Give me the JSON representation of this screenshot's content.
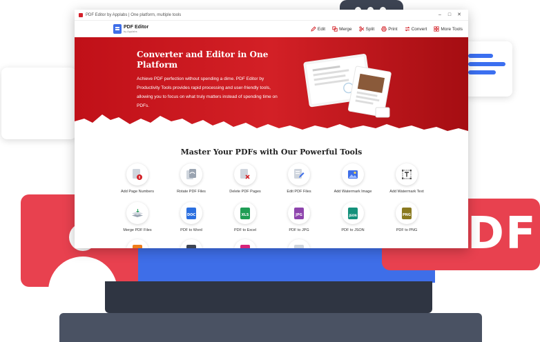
{
  "window": {
    "title": "PDF Editor by Applabs | One platform, multiple tools",
    "minimize": "–",
    "maximize": "□",
    "close": "✕"
  },
  "app": {
    "logo_name": "PDF Editor",
    "logo_sub": "by Applabs",
    "nav": [
      {
        "label": "Edit",
        "icon": "edit-icon"
      },
      {
        "label": "Merge",
        "icon": "merge-icon"
      },
      {
        "label": "Split",
        "icon": "split-icon"
      },
      {
        "label": "Print",
        "icon": "print-icon"
      },
      {
        "label": "Convert",
        "icon": "convert-icon"
      },
      {
        "label": "More Tools",
        "icon": "grid-icon"
      }
    ]
  },
  "hero": {
    "title": "Converter and Editor in One Platform",
    "description": "Achieve PDF perfection without spending a dime. PDF Editor by Productivity Tools provides rapid processing and user-friendly tools, allowing you to focus on what truly matters instead of spending time on PDFs."
  },
  "tools_section": {
    "title": "Master Your PDFs with Our Powerful Tools",
    "row1": [
      {
        "label": "Add Page Numbers",
        "icon": "page-number-icon"
      },
      {
        "label": "Rotate PDF Files",
        "icon": "rotate-icon"
      },
      {
        "label": "Delete PDF Pages",
        "icon": "delete-page-icon"
      },
      {
        "label": "Edit PDF Files",
        "icon": "edit-file-icon"
      },
      {
        "label": "Add Watermark Image",
        "icon": "watermark-image-icon"
      },
      {
        "label": "Add Watermark Text",
        "icon": "watermark-text-icon"
      }
    ],
    "row2": [
      {
        "label": "Merge PDF Files",
        "icon": "merge-files-icon"
      },
      {
        "label": "PDF to Word",
        "icon": "doc-file-icon",
        "tag": "DOC"
      },
      {
        "label": "PDF to Excel",
        "icon": "xls-file-icon",
        "tag": "XLS"
      },
      {
        "label": "PDF to JPG",
        "icon": "jpg-file-icon",
        "tag": "JPG"
      },
      {
        "label": "PDF to JSON",
        "icon": "json-file-icon",
        "tag": "JSON"
      },
      {
        "label": "PDF to PNG",
        "icon": "png-file-icon",
        "tag": "PNG"
      }
    ]
  },
  "decor": {
    "pdf_badge": "PDF"
  },
  "colors": {
    "accent_red": "#d32026",
    "brand_blue": "#3e6ee8",
    "doc_blue": "#2b6fe0",
    "xls_green": "#1f9d55",
    "jpg_purple": "#8e44ad",
    "json_teal": "#14917b",
    "png_olive": "#8a7a20"
  }
}
